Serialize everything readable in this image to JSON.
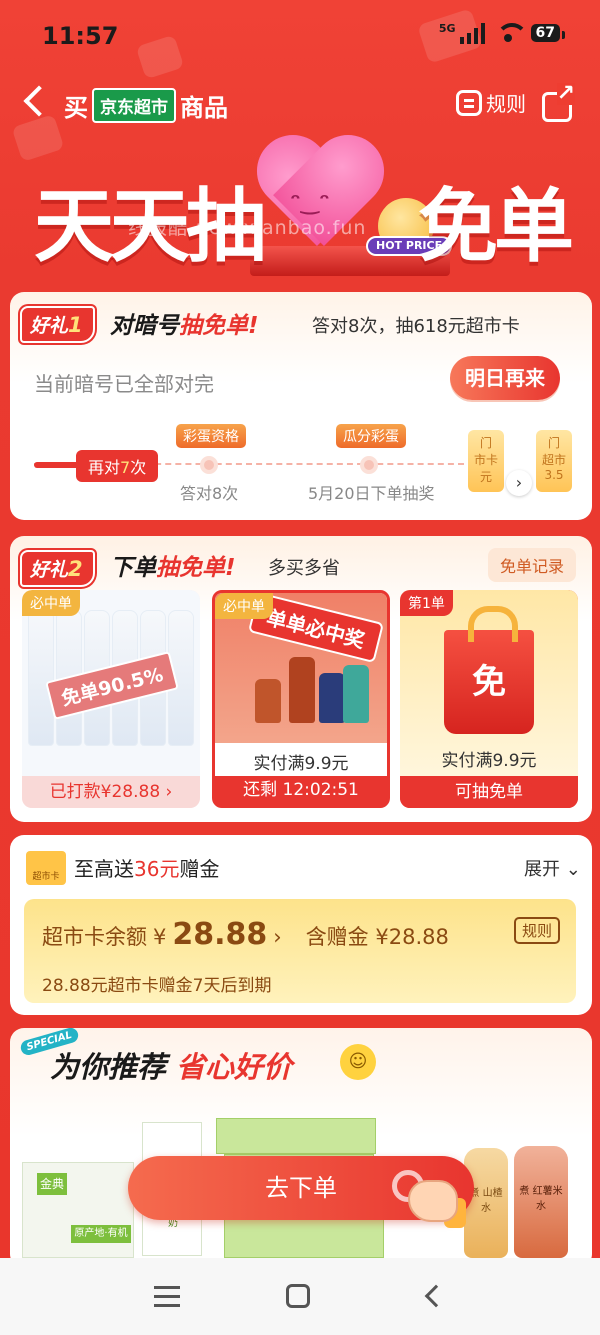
{
  "status_bar": {
    "time": "11:57",
    "network": "5G",
    "battery": "67"
  },
  "header": {
    "title_prefix": "买",
    "store_badge": "京东超市",
    "title_suffix": "商品",
    "rules_label": "规则"
  },
  "hero": {
    "title_left": "天天抽",
    "title_right": "免单",
    "hot_tag": "HOT PRICE",
    "watermark": "线报酷-new.xianbao.fun",
    "face": "ᵔ‿ᵔ"
  },
  "gift1": {
    "tag_prefix": "好礼",
    "tag_num": "1",
    "headline_a": "对暗号",
    "headline_b": "抽免单",
    "headline_c": "!",
    "subline": "答对8次，抽618元超市卡",
    "status": "当前暗号已全部对完",
    "button": "明日再来",
    "progress_now_a": "再对",
    "progress_now_num": "7",
    "progress_now_b": "次",
    "milestones": [
      {
        "tag": "彩蛋资格",
        "sub": "答对8次"
      },
      {
        "tag": "瓜分彩蛋",
        "sub": "5月20日下单抽奖"
      }
    ],
    "mini_cards": [
      {
        "top": "门",
        "mid": "市卡",
        "bottom": "元"
      },
      {
        "top": "门",
        "mid": "超市",
        "bottom": "3.5"
      }
    ],
    "mini_arrow": "›"
  },
  "gift2": {
    "tag_prefix": "好礼",
    "tag_num": "2",
    "headline_a": "下单",
    "headline_b": "抽免单",
    "headline_c": "!",
    "subline": "多买多省",
    "record_button": "免单记录",
    "products": [
      {
        "badge": "必中单",
        "stamp": "免单90.5%",
        "footer": "已打款¥28.88 ›"
      },
      {
        "badge": "必中单",
        "banner": "单单必中奖",
        "price": "实付满9.9元",
        "footer": "还剩 12:02:51"
      },
      {
        "badge": "第1单",
        "bag_text": "免",
        "price": "实付满9.9元",
        "footer": "可抽免单"
      }
    ]
  },
  "supermarket_card": {
    "icon_text": "超市卡",
    "title_a": "至高送",
    "title_amount": "36元",
    "title_b": "赠金",
    "expand": "展开 ⌄",
    "balance_label": "超市卡余额",
    "balance_currency": "¥",
    "balance_value": "28.88",
    "balance_arrow": "›",
    "gift_label": "含赠金 ¥28.88",
    "rules": "规则",
    "expire_note": "28.88元超市卡赠金7天后到期"
  },
  "recommend": {
    "special": "SPECIAL",
    "title_a": "为你推荐",
    "title_b": "省心好价",
    "smiley": "☺",
    "products": [
      {
        "brand": "金典",
        "line": "原产地·有机"
      },
      {
        "brand": "有机纯牛奶"
      },
      {
        "brand": "煮 红薯米水"
      },
      {
        "brand": "煮 山楂水"
      }
    ]
  },
  "cta": {
    "label": "去下单"
  },
  "colors": {
    "primary": "#e8352f",
    "gold": "#ffc447",
    "brown": "#8a4a12",
    "green": "#1a9a4a"
  }
}
